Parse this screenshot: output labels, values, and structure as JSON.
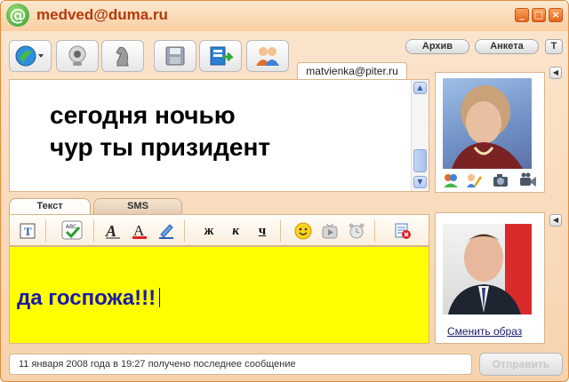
{
  "window": {
    "title": "medved@duma.ru",
    "logo_glyph": "@",
    "controls": {
      "minimize": "_",
      "maximize": "□",
      "close": "×"
    }
  },
  "toolbar": {
    "buttons": [
      {
        "name": "status-menu-button",
        "icon": "status-globe-icon"
      },
      {
        "name": "webcam-button",
        "icon": "webcam-icon"
      },
      {
        "name": "game-button",
        "icon": "chess-knight-icon"
      },
      {
        "name": "save-button",
        "icon": "floppy-disk-icon"
      },
      {
        "name": "transfer-button",
        "icon": "file-transfer-icon"
      },
      {
        "name": "contacts-button",
        "icon": "users-icon"
      }
    ],
    "archive_label": "Архив",
    "profile_label": "Анкета",
    "pin_label": "T"
  },
  "incoming": {
    "contact_email": "matvienka@piter.ru",
    "message_line1": "сегодня ночью",
    "message_line2": "чур ты призидент"
  },
  "tabs": {
    "text_label": "Текст",
    "sms_label": "SMS"
  },
  "format_toolbar": {
    "bold_label": "ж",
    "italic_label": "к",
    "underline_label": "ч"
  },
  "compose": {
    "text": "да госпожа!!!"
  },
  "avatar": {
    "change_link": "Сменить образ"
  },
  "status": {
    "text": "11 января 2008 года в 19:27 получено последнее сообщение"
  },
  "send": {
    "label": "Отправить"
  },
  "colors": {
    "compose_bg": "#ffff00",
    "accent": "#e3641c",
    "compose_text": "#1a1aa8"
  }
}
